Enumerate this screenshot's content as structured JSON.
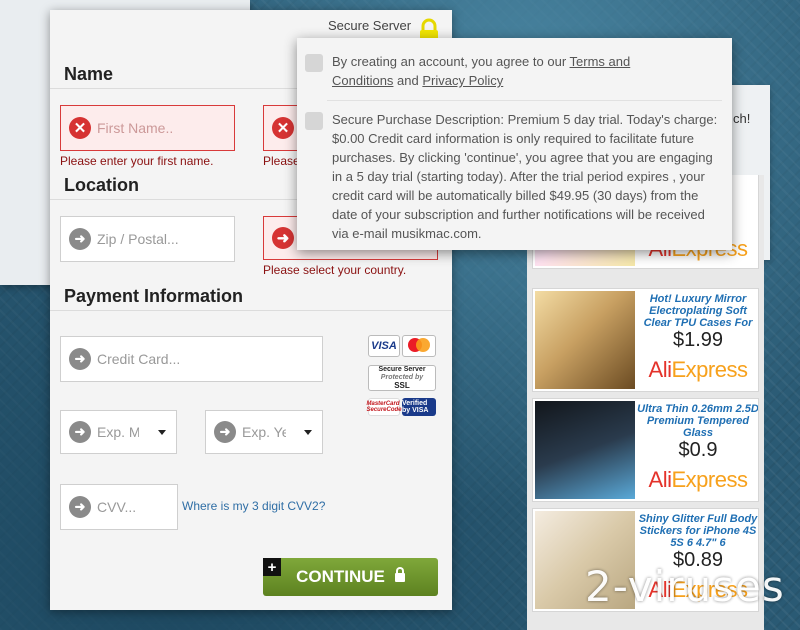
{
  "form": {
    "secure_server_label": "Secure Server",
    "sections": {
      "name": "Name",
      "location": "Location",
      "payment": "Payment Information"
    },
    "first_name": {
      "placeholder": "First Name..",
      "error": "Please enter your first name."
    },
    "last_name": {
      "error": "Please"
    },
    "zip": {
      "placeholder": "Zip / Postal..."
    },
    "country": {
      "error": "Please select your country."
    },
    "credit_card": {
      "placeholder": "Credit Card..."
    },
    "exp_month": {
      "placeholder": "Exp. Mo"
    },
    "exp_year": {
      "placeholder": "Exp. Ye"
    },
    "cvv": {
      "placeholder": "CVV...",
      "help_link": "Where is my 3 digit CVV2?"
    },
    "badges": {
      "visa": "VISA",
      "mastercard": "MasterCard",
      "secure_server_line1": "Secure Server",
      "secure_server_line2": "Protected by",
      "secure_server_line3": "SSL",
      "mc_securecode": "MasterCard SecureCode",
      "verified_by_visa": "Verified by VISA"
    },
    "continue_label": "CONTINUE",
    "continue_plus": "+"
  },
  "popup": {
    "terms_prefix": "By creating an account, you agree to our ",
    "terms_link": "Terms and Conditions",
    "terms_and": " and ",
    "privacy_link": "Privacy Policy",
    "purchase_description": "Secure Purchase Description: Premium 5 day trial. Today's charge: $0.00 Credit card information is only required to facilitate future purchases. By clicking 'continue', you agree that you are engaging in a 5 day trial (starting today). After the trial period expires , your credit card will be automatically billed $49.95 (30 days) from the date of your subscription and further notifications will be received via e-mail musikmac.com."
  },
  "background": {
    "right_fragment": "ch!"
  },
  "ads": [
    {
      "title": "",
      "price": "",
      "logo_main": "Ali",
      "logo_accent": "Express",
      "colors": [
        "#c9d8f0",
        "#ffe2f0"
      ]
    },
    {
      "title": "Hot! Luxury Mirror Electroplating Soft Clear TPU Cases For",
      "price": "$1.99",
      "logo_main": "Ali",
      "logo_accent": "Express",
      "colors": [
        "#e8c98a",
        "#9a7440"
      ]
    },
    {
      "title": "Ultra Thin 0.26mm 2.5D Premium Tempered Glass",
      "price": "$0.9",
      "logo_main": "Ali",
      "logo_accent": "Express",
      "colors": [
        "#1b1f24",
        "#5aa9d8"
      ]
    },
    {
      "title": "Shiny Glitter Full Body Stickers for iPhone 4S 5S 6 4.7\" 6",
      "price": "$0.89",
      "logo_main": "Ali",
      "logo_accent": "Express",
      "colors": [
        "#d9c9a8",
        "#f4ece0"
      ]
    }
  ],
  "watermark": "2-viruses",
  "colors": {
    "error_red": "#d63333",
    "continue_green": "#6e9630",
    "link_blue": "#2f6ea5",
    "aliexpress_red": "#e4332b"
  }
}
